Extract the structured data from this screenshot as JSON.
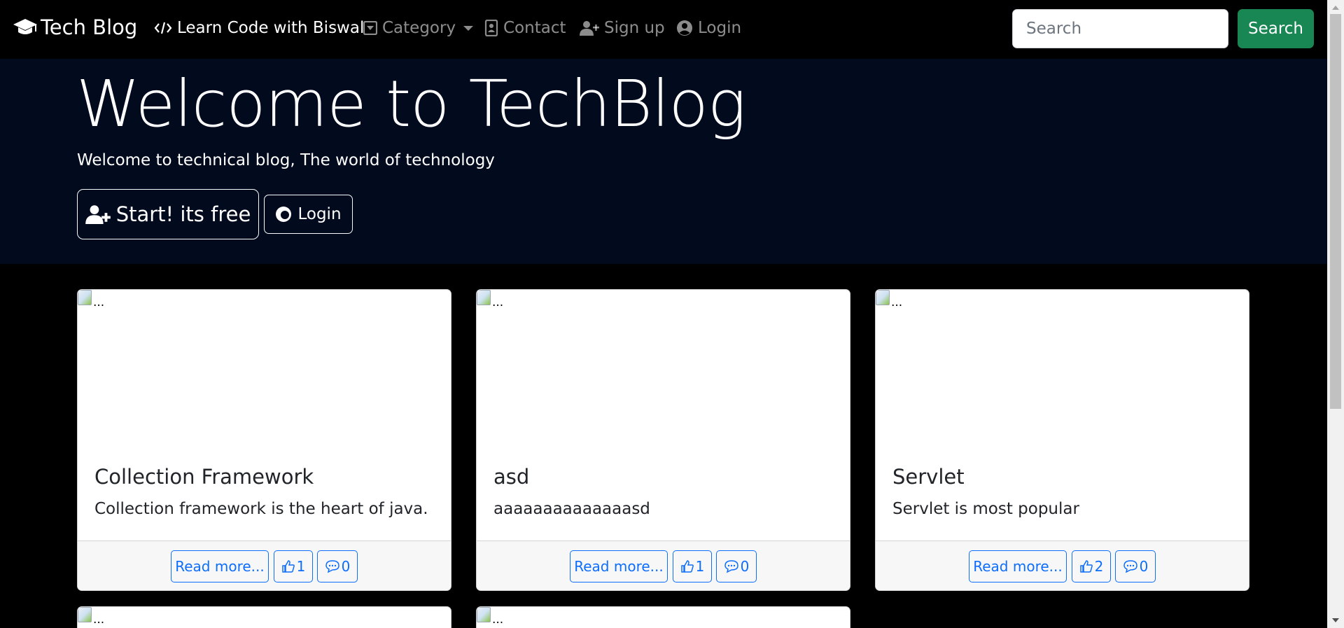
{
  "navbar": {
    "brand": "Tech Blog",
    "items": [
      {
        "label": "Learn Code with Biswal",
        "icon": "code-icon",
        "active": true
      },
      {
        "label": "Category",
        "icon": "caret-square-icon",
        "dropdown": true
      },
      {
        "label": "Contact",
        "icon": "address-book-icon"
      },
      {
        "label": "Sign up",
        "icon": "user-plus-icon"
      },
      {
        "label": "Login",
        "icon": "user-circle-icon"
      }
    ],
    "search_placeholder": "Search",
    "search_button": "Search"
  },
  "hero": {
    "title": "Welcome to TechBlog",
    "subtitle": "Welcome to technical blog, The world of technology",
    "start_button": "Start! its free",
    "login_button": "Login"
  },
  "posts": [
    {
      "img_alt": "...",
      "title": "Collection Framework",
      "text": "Collection framework is the heart of java.",
      "read_more": "Read more...",
      "likes": "1",
      "comments": "0"
    },
    {
      "img_alt": "...",
      "title": "asd",
      "text": "aaaaaaaaaaaaaasd",
      "read_more": "Read more...",
      "likes": "1",
      "comments": "0"
    },
    {
      "img_alt": "...",
      "title": "Servlet",
      "text": "Servlet is most popular",
      "read_more": "Read more...",
      "likes": "2",
      "comments": "0"
    },
    {
      "img_alt": "..."
    },
    {
      "img_alt": "..."
    }
  ],
  "colors": {
    "hero_bg": "#020a1e",
    "search_button_bg": "#198754",
    "link_blue": "#0d6efd"
  }
}
